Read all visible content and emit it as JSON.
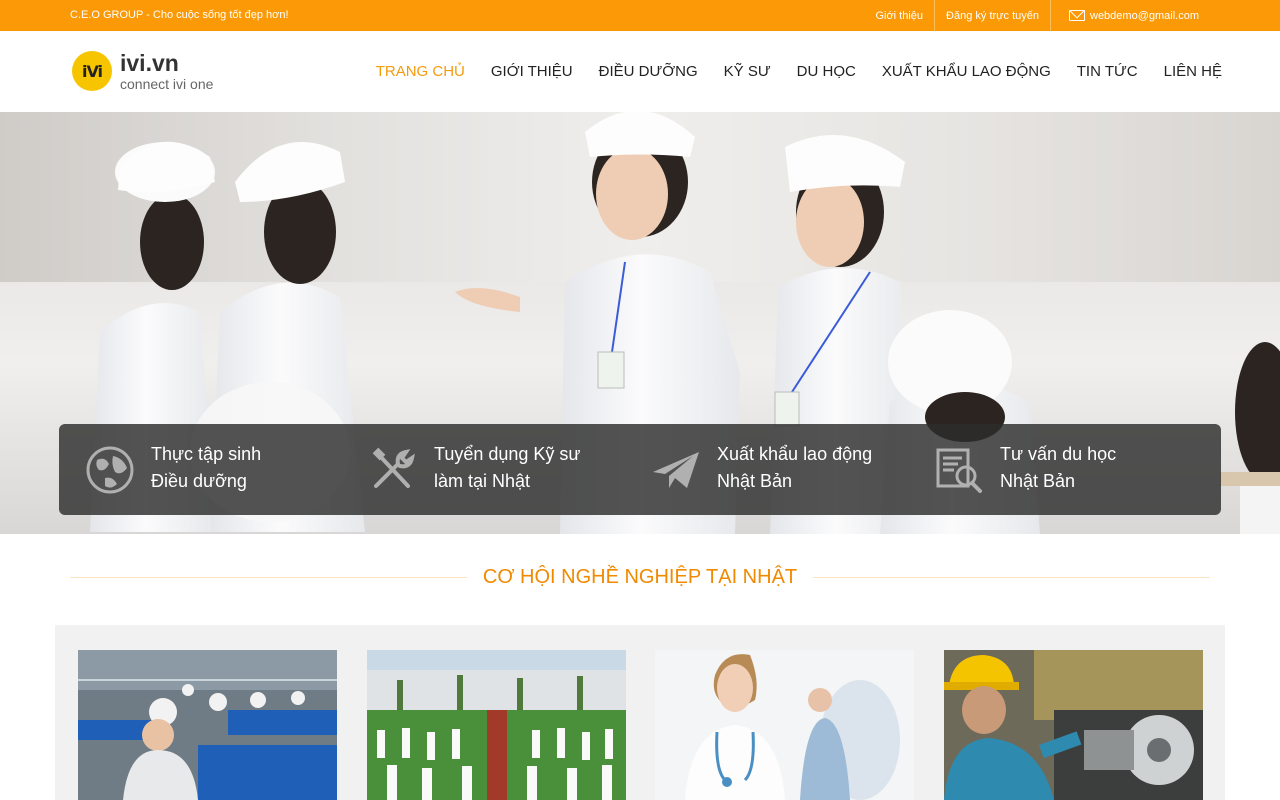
{
  "topbar": {
    "tagline": "C.E.O GROUP - Cho cuộc sống tốt đẹp hơn!",
    "links": [
      "Giới thiệu",
      "Đăng ký trực tuyến"
    ],
    "email": "webdemo@gmail.com"
  },
  "logo": {
    "badge": "iVi",
    "brand": "ivi.vn",
    "slogan": "connect ivi one"
  },
  "nav": [
    "TRANG CHỦ",
    "GIỚI THIỆU",
    "ĐIỀU DƯỠNG",
    "KỸ SƯ",
    "DU HỌC",
    "XUẤT KHẨU LAO ĐỘNG",
    "TIN TỨC",
    "LIÊN HỆ"
  ],
  "services": [
    {
      "line1": "Thực tập sinh",
      "line2": "Điều dưỡng",
      "icon": "globe-icon"
    },
    {
      "line1": "Tuyển dụng Kỹ sư",
      "line2": "làm tại Nhật",
      "icon": "tools-icon"
    },
    {
      "line1": "Xuất khẩu lao động",
      "line2": "Nhật Bản",
      "icon": "paper-plane-icon"
    },
    {
      "line1": "Tư vấn du học",
      "line2": "Nhật Bản",
      "icon": "search-document-icon"
    }
  ],
  "section": {
    "title": "CƠ HỘI NGHỀ NGHIỆP TẠI NHẬT"
  },
  "colors": {
    "accent": "#fb9a06",
    "nav_active": "#f49b0c",
    "section_title": "#f08a00"
  }
}
